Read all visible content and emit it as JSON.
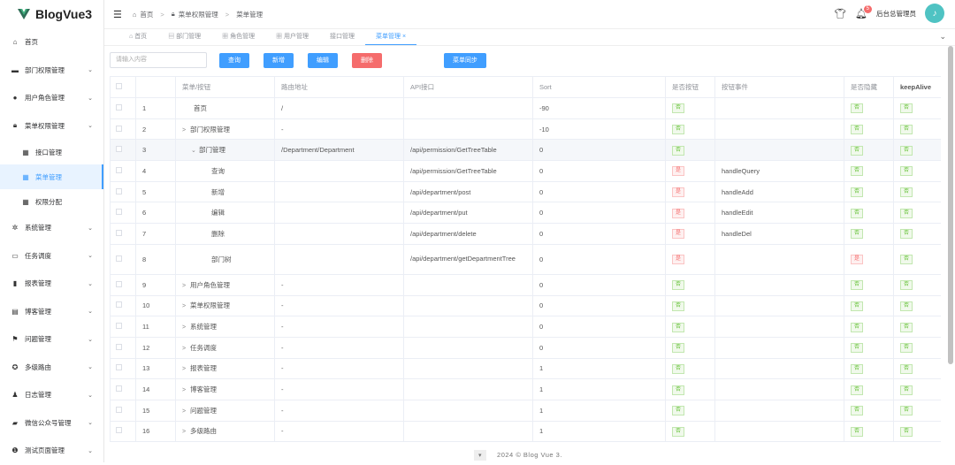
{
  "app": {
    "title": "BlogVue3"
  },
  "sidebar": {
    "items": [
      {
        "label": "首页",
        "icon": "home-icon"
      },
      {
        "label": "部门权限管理",
        "icon": "briefcase-icon"
      },
      {
        "label": "用户角色管理",
        "icon": "user-icon"
      },
      {
        "label": "菜单权限管理",
        "icon": "lock-icon"
      },
      {
        "label": "接口管理",
        "icon": "grid-icon"
      },
      {
        "label": "菜单管理",
        "icon": "grid-icon"
      },
      {
        "label": "权限分配",
        "icon": "grid-icon"
      },
      {
        "label": "系统管理",
        "icon": "gear-icon"
      },
      {
        "label": "任务调度",
        "icon": "ticket-icon"
      },
      {
        "label": "报表管理",
        "icon": "bar-chart-icon"
      },
      {
        "label": "博客管理",
        "icon": "document-icon"
      },
      {
        "label": "问题管理",
        "icon": "flag-icon"
      },
      {
        "label": "多级路由",
        "icon": "compass-icon"
      },
      {
        "label": "日志管理",
        "icon": "user-log-icon"
      },
      {
        "label": "微信公众号管理",
        "icon": "chat-icon"
      },
      {
        "label": "测试页面管理",
        "icon": "info-icon"
      }
    ]
  },
  "header": {
    "breadcrumb": [
      "首页",
      "菜单权限管理",
      "菜单管理"
    ],
    "notif_count": "5",
    "user": "后台总管理员"
  },
  "tabs": [
    "首页",
    "部门管理",
    "角色管理",
    "用户管理",
    "接口管理",
    "菜单管理"
  ],
  "toolbar": {
    "placeholder": "请输入内容",
    "query": "查询",
    "add": "新增",
    "edit": "编辑",
    "delete": "删除",
    "sync": "菜单同步"
  },
  "table": {
    "headers": [
      "菜单/按钮",
      "路由地址",
      "API接口",
      "Sort",
      "是否按钮",
      "按钮事件",
      "是否隐藏",
      "keepAlive"
    ],
    "rows": [
      {
        "id": "1",
        "name": "首页",
        "route": "/",
        "api": "",
        "sort": "-90",
        "is_btn": "否",
        "event": "",
        "hidden": "否",
        "keep": "否"
      },
      {
        "id": "2",
        "name": "部门权限管理",
        "route": "-",
        "api": "",
        "sort": "-10",
        "is_btn": "否",
        "event": "",
        "hidden": "否",
        "keep": "否"
      },
      {
        "id": "3",
        "name": "部门管理",
        "route": "/Department/Department",
        "api": "/api/permission/GetTreeTable",
        "sort": "0",
        "is_btn": "否",
        "event": "",
        "hidden": "否",
        "keep": "否"
      },
      {
        "id": "4",
        "name": "查询",
        "route": "",
        "api": "/api/permission/GetTreeTable",
        "sort": "0",
        "is_btn": "是",
        "event": "handleQuery",
        "hidden": "否",
        "keep": "否"
      },
      {
        "id": "5",
        "name": "新增",
        "route": "",
        "api": "/api/department/post",
        "sort": "0",
        "is_btn": "是",
        "event": "handleAdd",
        "hidden": "否",
        "keep": "否"
      },
      {
        "id": "6",
        "name": "编辑",
        "route": "",
        "api": "/api/department/put",
        "sort": "0",
        "is_btn": "是",
        "event": "handleEdit",
        "hidden": "否",
        "keep": "否"
      },
      {
        "id": "7",
        "name": "删除",
        "route": "",
        "api": "/api/department/delete",
        "sort": "0",
        "is_btn": "是",
        "event": "handleDel",
        "hidden": "否",
        "keep": "否"
      },
      {
        "id": "8",
        "name": "部门树",
        "route": "",
        "api": "/api/department/getDepartmentTree",
        "sort": "0",
        "is_btn": "是",
        "event": "",
        "hidden": "是",
        "keep": "否"
      },
      {
        "id": "9",
        "name": "用户角色管理",
        "route": "-",
        "api": "",
        "sort": "0",
        "is_btn": "否",
        "event": "",
        "hidden": "否",
        "keep": "否"
      },
      {
        "id": "10",
        "name": "菜单权限管理",
        "route": "-",
        "api": "",
        "sort": "0",
        "is_btn": "否",
        "event": "",
        "hidden": "否",
        "keep": "否"
      },
      {
        "id": "11",
        "name": "系统管理",
        "route": "-",
        "api": "",
        "sort": "0",
        "is_btn": "否",
        "event": "",
        "hidden": "否",
        "keep": "否"
      },
      {
        "id": "12",
        "name": "任务调度",
        "route": "-",
        "api": "",
        "sort": "0",
        "is_btn": "否",
        "event": "",
        "hidden": "否",
        "keep": "否"
      },
      {
        "id": "13",
        "name": "报表管理",
        "route": "-",
        "api": "",
        "sort": "1",
        "is_btn": "否",
        "event": "",
        "hidden": "否",
        "keep": "否"
      },
      {
        "id": "14",
        "name": "博客管理",
        "route": "-",
        "api": "",
        "sort": "1",
        "is_btn": "否",
        "event": "",
        "hidden": "否",
        "keep": "否"
      },
      {
        "id": "15",
        "name": "问题管理",
        "route": "-",
        "api": "",
        "sort": "1",
        "is_btn": "否",
        "event": "",
        "hidden": "否",
        "keep": "否"
      },
      {
        "id": "16",
        "name": "多级路由",
        "route": "-",
        "api": "",
        "sort": "1",
        "is_btn": "否",
        "event": "",
        "hidden": "否",
        "keep": "否"
      }
    ]
  },
  "footer": "2024 © Blog Vue 3."
}
